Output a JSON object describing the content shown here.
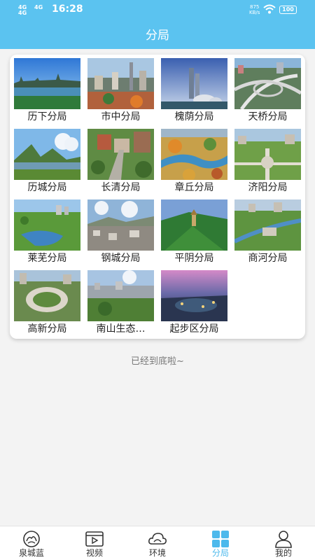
{
  "status_bar": {
    "network_top": "4G",
    "network_bottom": "4G",
    "network_right": "4G",
    "time": "16:28",
    "speed_value": "875",
    "speed_unit": "KB/s",
    "battery": "100"
  },
  "header": {
    "title": "分局"
  },
  "branches": [
    {
      "label": "历下分局",
      "image": "lake-city-skyline"
    },
    {
      "label": "市中分局",
      "image": "city-tower-aerial"
    },
    {
      "label": "槐荫分局",
      "image": "towers-dome-night"
    },
    {
      "label": "天桥分局",
      "image": "highway-interchange"
    },
    {
      "label": "历城分局",
      "image": "mountain-lake"
    },
    {
      "label": "长清分局",
      "image": "campus-road"
    },
    {
      "label": "章丘分局",
      "image": "autumn-river-aerial"
    },
    {
      "label": "济阳分局",
      "image": "green-plaza-aerial"
    },
    {
      "label": "莱芜分局",
      "image": "green-lake-park"
    },
    {
      "label": "钢城分局",
      "image": "town-hills"
    },
    {
      "label": "平阴分局",
      "image": "forest-temple"
    },
    {
      "label": "商河分局",
      "image": "river-park-city"
    },
    {
      "label": "高新分局",
      "image": "round-building-park"
    },
    {
      "label": "南山生态…",
      "image": "hill-city-view"
    },
    {
      "label": "起步区分局",
      "image": "night-expo-aerial"
    }
  ],
  "end_note": "已经到底啦~",
  "tabbar": {
    "active": "fenju",
    "items": [
      {
        "key": "quanchenglan",
        "label": "泉城蓝",
        "icon": "city-logo-icon"
      },
      {
        "key": "shipin",
        "label": "视频",
        "icon": "video-player-icon"
      },
      {
        "key": "huanjing",
        "label": "环境",
        "icon": "cloud-icon"
      },
      {
        "key": "fenju",
        "label": "分局",
        "icon": "grid-icon"
      },
      {
        "key": "wode",
        "label": "我的",
        "icon": "person-icon"
      }
    ]
  },
  "colors": {
    "header": "#5bc3f0",
    "active_tab": "#4cb9ec"
  }
}
